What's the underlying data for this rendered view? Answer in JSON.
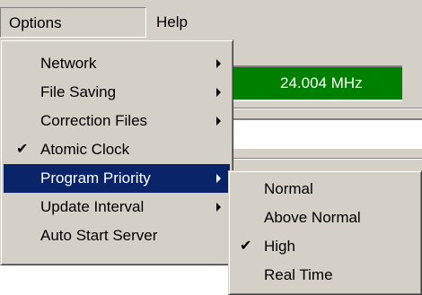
{
  "menubar": {
    "options_label": "Options",
    "help_label": "Help"
  },
  "background": {
    "frequency_text": "24.004 MHz",
    "frequency_bg_color": "#008000"
  },
  "options_menu": {
    "items": [
      {
        "label": "Network",
        "checked": false,
        "has_submenu": true,
        "highlighted": false
      },
      {
        "label": "File Saving",
        "checked": false,
        "has_submenu": true,
        "highlighted": false
      },
      {
        "label": "Correction Files",
        "checked": false,
        "has_submenu": true,
        "highlighted": false
      },
      {
        "label": "Atomic Clock",
        "checked": true,
        "has_submenu": false,
        "highlighted": false
      },
      {
        "label": "Program Priority",
        "checked": false,
        "has_submenu": true,
        "highlighted": true
      },
      {
        "label": "Update Interval",
        "checked": false,
        "has_submenu": true,
        "highlighted": false
      },
      {
        "label": "Auto Start Server",
        "checked": false,
        "has_submenu": false,
        "highlighted": false
      }
    ]
  },
  "priority_menu": {
    "items": [
      {
        "label": "Normal",
        "checked": false
      },
      {
        "label": "Above Normal",
        "checked": false
      },
      {
        "label": "High",
        "checked": true
      },
      {
        "label": "Real Time",
        "checked": false
      }
    ]
  },
  "icons": {
    "check_glyph": "✔",
    "highlight_color": "#0a246a",
    "menu_bg_color": "#d4d0c8"
  }
}
